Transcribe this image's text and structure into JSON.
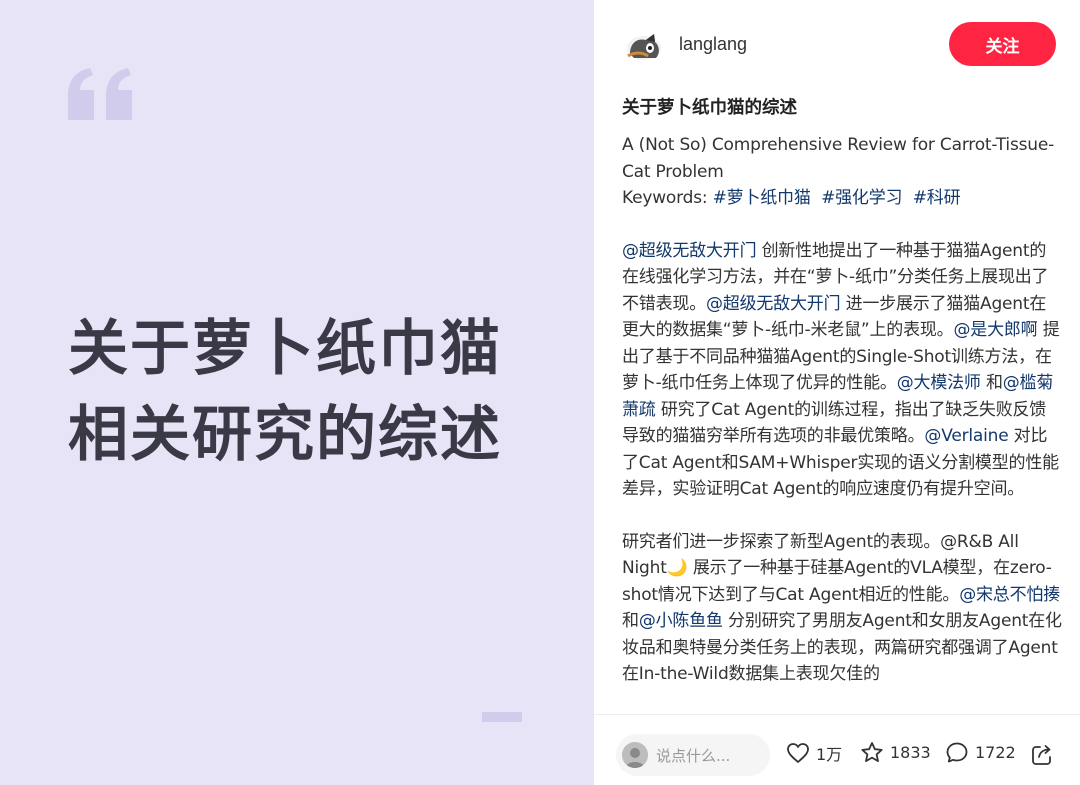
{
  "cover": {
    "line1": "关于萝卜纸巾猫",
    "line2": "相关研究的综述"
  },
  "author": {
    "name": "langlang",
    "follow_label": "关注"
  },
  "note": {
    "title": "关于萝卜纸巾猫的综述",
    "subtitle": "A (Not So) Comprehensive Review for Carrot-Tissue-Cat Problem",
    "keywords_label": "Keywords: ",
    "tags": [
      "#萝卜纸巾猫",
      "#强化学习",
      "#科研"
    ],
    "p1": {
      "m1": "@超级无敌大开门",
      "t1": " 创新性地提出了一种基于猫猫Agent的在线强化学习方法，并在“萝卜-纸巾”分类任务上展现出了不错表现。",
      "m2": "@超级无敌大开门",
      "t2": " 进一步展示了猫猫Agent在更大的数据集“萝卜-纸巾-米老鼠”上的表现。",
      "m3": "@是大郎啊",
      "t3": " 提出了基于不同品种猫猫Agent的Single-Shot训练方法，在萝卜-纸巾任务上体现了优异的性能。",
      "m4": "@大模法师",
      "t4": " 和",
      "m5": "@槛菊萧疏",
      "t5": " 研究了Cat Agent的训练过程，指出了缺乏失败反馈导致的猫猫穷举所有选项的非最优策略。",
      "m6": "@Verlaine",
      "t6": " 对比了Cat Agent和SAM+Whisper实现的语义分割模型的性能差异，实验证明Cat Agent的响应速度仍有提升空间。"
    },
    "p2": {
      "t1": "研究者们进一步探索了新型Agent的表现。@R&B All Night🌙 展示了一种基于硅基Agent的VLA模型，在zero-shot情况下达到了与Cat Agent相近的性能。",
      "m1": "@宋总不怕揍",
      "t2": " 和",
      "m2": "@小陈鱼鱼",
      "t3": " 分别研究了男朋友Agent和女朋友Agent在化妆品和奥特曼分类任务上的表现，两篇研究都强调了Agent在In-the-Wild数据集上表现欠佳的"
    }
  },
  "bottom": {
    "comment_placeholder": "说点什么...",
    "likes": "1万",
    "collects": "1833",
    "comments": "1722"
  },
  "icons": {
    "quote": "quote-mark-icon",
    "like": "heart-icon",
    "collect": "star-icon",
    "comment": "chat-bubble-icon",
    "share": "share-icon"
  },
  "colors": {
    "accent": "#ff2442",
    "mention": "#13386c",
    "cover_bg": "#e8e4f7"
  }
}
